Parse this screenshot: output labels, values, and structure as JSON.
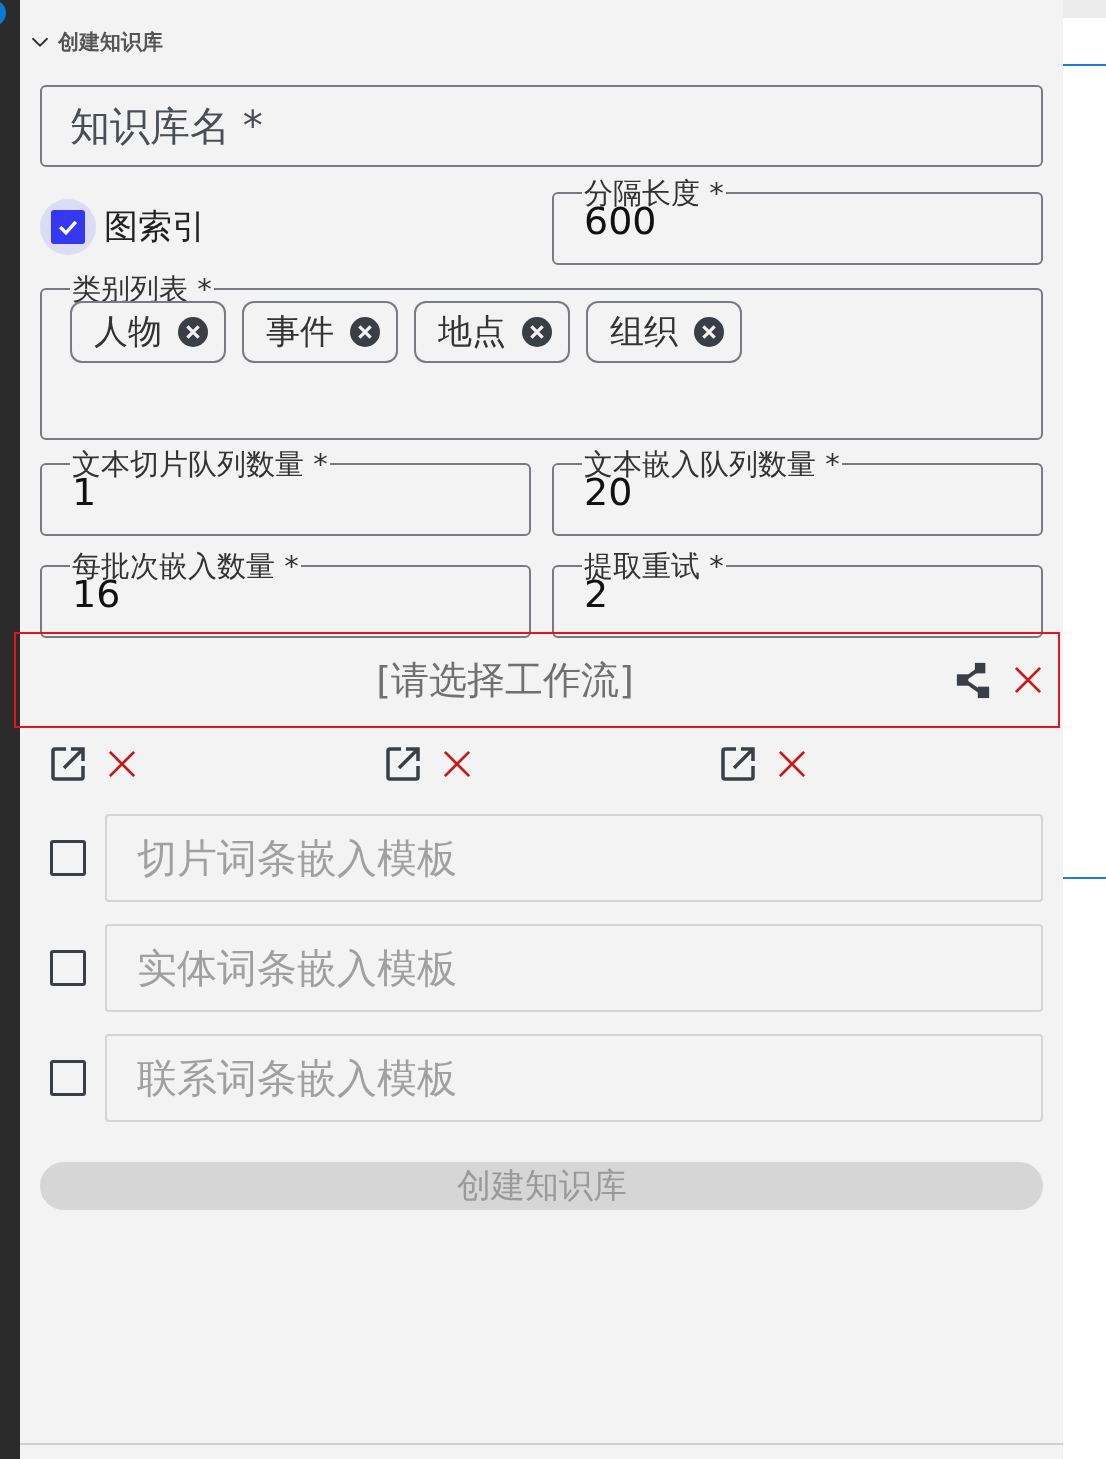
{
  "section": {
    "title": "创建知识库",
    "expanded": true
  },
  "name_field": {
    "placeholder": "知识库名 *"
  },
  "graph_index": {
    "label": "图索引",
    "checked": true
  },
  "chunk_length": {
    "label": "分隔长度 *",
    "value": "600"
  },
  "categories": {
    "label": "类别列表 *",
    "chips": [
      "人物",
      "事件",
      "地点",
      "组织"
    ]
  },
  "number_fields": [
    {
      "label": "文本切片队列数量 *",
      "value": "1"
    },
    {
      "label": "文本嵌入队列数量 *",
      "value": "20"
    },
    {
      "label": "每批次嵌入数量 *",
      "value": "16"
    },
    {
      "label": "提取重试 *",
      "value": "2"
    }
  ],
  "workflow": {
    "placeholder": "[请选择工作流]",
    "highlighted": true
  },
  "workflow_slots": [
    {
      "kind": "link"
    },
    {
      "kind": "link"
    },
    {
      "kind": "link"
    }
  ],
  "templates": [
    {
      "placeholder": "切片词条嵌入模板",
      "checked": false
    },
    {
      "placeholder": "实体词条嵌入模板",
      "checked": false
    },
    {
      "placeholder": "联系词条嵌入模板",
      "checked": false
    }
  ],
  "submit": {
    "label": "创建知识库",
    "disabled": true
  }
}
